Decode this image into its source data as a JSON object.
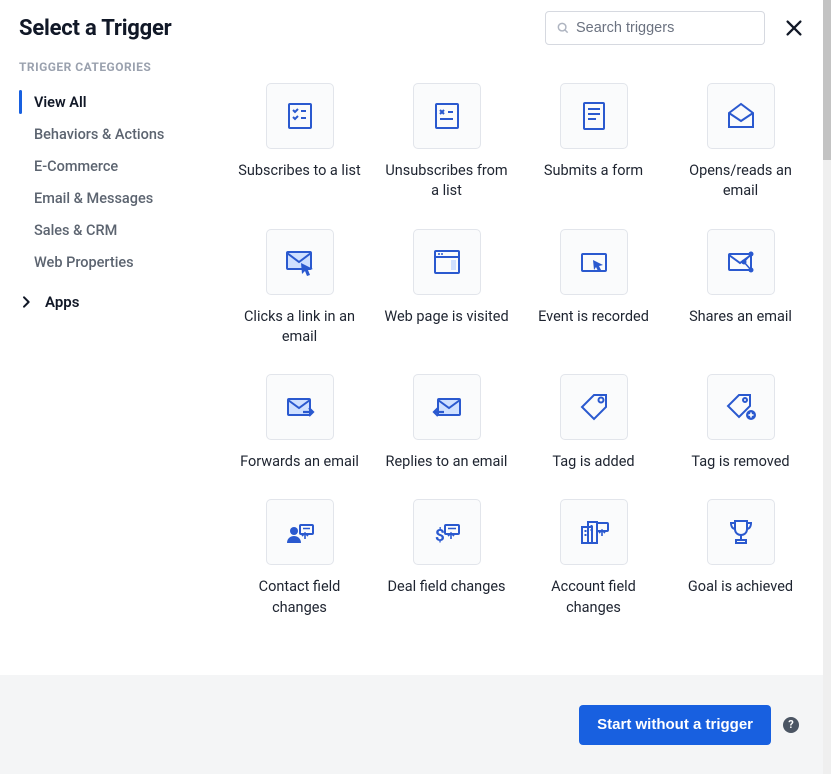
{
  "header": {
    "title": "Select a Trigger",
    "search_placeholder": "Search triggers"
  },
  "sidebar": {
    "heading": "TRIGGER CATEGORIES",
    "items": [
      {
        "label": "View All",
        "active": true
      },
      {
        "label": "Behaviors & Actions",
        "active": false
      },
      {
        "label": "E-Commerce",
        "active": false
      },
      {
        "label": "Email & Messages",
        "active": false
      },
      {
        "label": "Sales & CRM",
        "active": false
      },
      {
        "label": "Web Properties",
        "active": false
      }
    ],
    "apps_label": "Apps"
  },
  "triggers": [
    {
      "label": "Subscribes to a list",
      "icon": "checklist"
    },
    {
      "label": "Unsubscribes from a list",
      "icon": "checklist-off"
    },
    {
      "label": "Submits a form",
      "icon": "form"
    },
    {
      "label": "Opens/reads an email",
      "icon": "mail-open"
    },
    {
      "label": "Clicks a link in an email",
      "icon": "mail-click"
    },
    {
      "label": "Web page is visited",
      "icon": "webpage"
    },
    {
      "label": "Event is recorded",
      "icon": "event"
    },
    {
      "label": "Shares an email",
      "icon": "mail-share"
    },
    {
      "label": "Forwards an email",
      "icon": "mail-forward"
    },
    {
      "label": "Replies to an email",
      "icon": "mail-reply"
    },
    {
      "label": "Tag is added",
      "icon": "tag"
    },
    {
      "label": "Tag is removed",
      "icon": "tag-remove"
    },
    {
      "label": "Contact field changes",
      "icon": "contact-field"
    },
    {
      "label": "Deal field changes",
      "icon": "deal-field"
    },
    {
      "label": "Account field changes",
      "icon": "account-field"
    },
    {
      "label": "Goal is achieved",
      "icon": "trophy"
    }
  ],
  "footer": {
    "primary": "Start without a trigger"
  },
  "colors": {
    "accent": "#1860e0",
    "icon": "#2a59cf"
  }
}
